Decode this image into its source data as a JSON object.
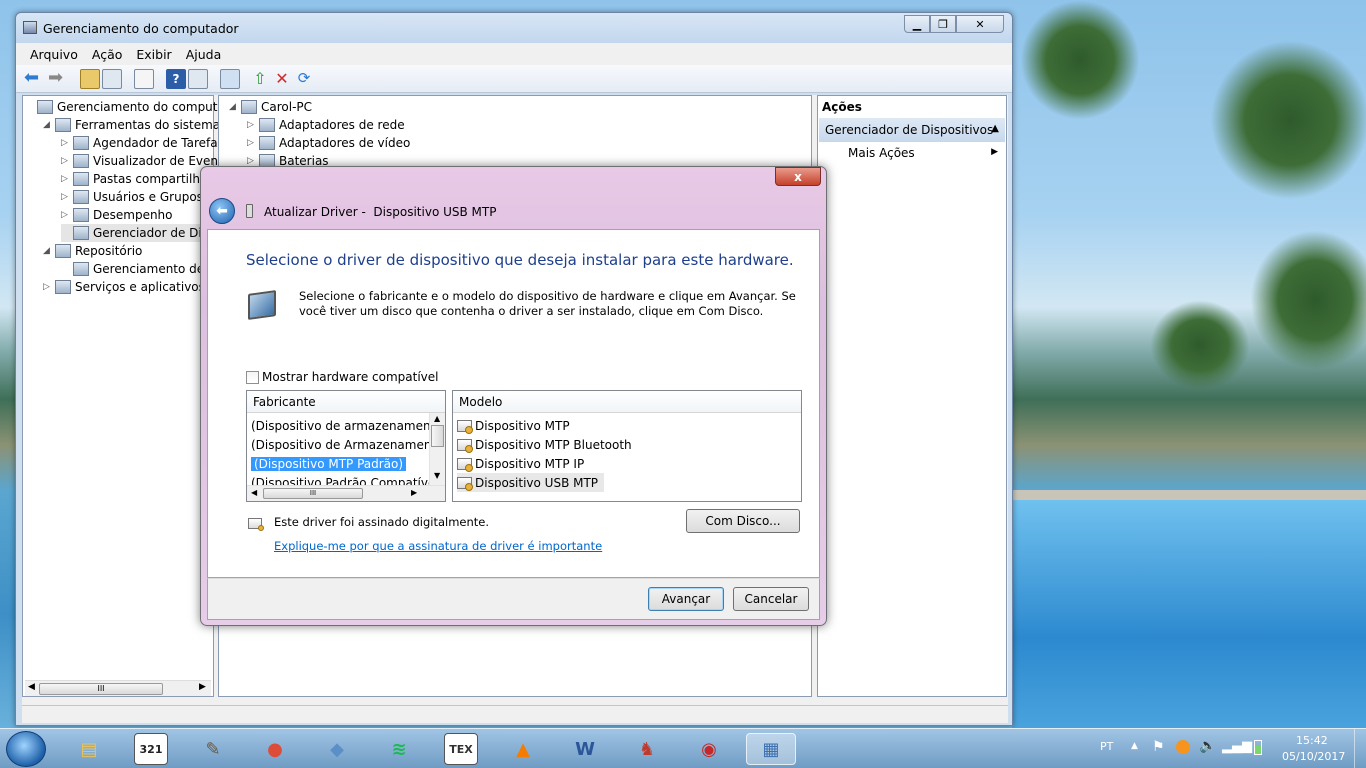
{
  "main_window": {
    "title": "Gerenciamento do computador",
    "menu": [
      "Arquivo",
      "Ação",
      "Exibir",
      "Ajuda"
    ],
    "left_tree": [
      {
        "label": "Gerenciamento do computado",
        "indent": 0,
        "arrow": ""
      },
      {
        "label": "Ferramentas do sistema",
        "indent": 1,
        "arrow": "◢"
      },
      {
        "label": "Agendador de Tarefas",
        "indent": 2,
        "arrow": "▷"
      },
      {
        "label": "Visualizador de Eventos",
        "indent": 2,
        "arrow": "▷"
      },
      {
        "label": "Pastas compartilhada",
        "indent": 2,
        "arrow": "▷"
      },
      {
        "label": "Usuários e Grupos Loc",
        "indent": 2,
        "arrow": "▷"
      },
      {
        "label": "Desempenho",
        "indent": 2,
        "arrow": "▷"
      },
      {
        "label": "Gerenciador de Dispo",
        "indent": 2,
        "arrow": ""
      },
      {
        "label": "Repositório",
        "indent": 1,
        "arrow": "◢"
      },
      {
        "label": "Gerenciamento de dis",
        "indent": 2,
        "arrow": ""
      },
      {
        "label": "Serviços e aplicativos",
        "indent": 1,
        "arrow": "▷"
      }
    ],
    "device_tree": [
      {
        "label": "Carol-PC",
        "indent": 0,
        "arrow": "◢"
      },
      {
        "label": "Adaptadores de rede",
        "indent": 1,
        "arrow": "▷"
      },
      {
        "label": "Adaptadores de vídeo",
        "indent": 1,
        "arrow": "▷"
      },
      {
        "label": "Baterias",
        "indent": 1,
        "arrow": "▷"
      }
    ],
    "actions": {
      "header": "Ações",
      "section": "Gerenciador de Dispositivos",
      "more": "Mais Ações"
    },
    "scroll_grip": "III"
  },
  "dialog": {
    "breadcrumb": "Atualizar Driver -  Dispositivo USB MTP",
    "heading": "Selecione o driver de dispositivo que deseja instalar para este hardware.",
    "description": "Selecione o fabricante e o modelo do dispositivo de hardware e clique em Avançar. Se você tiver um disco que contenha o driver a ser instalado, clique em Com Disco.",
    "checkbox_label": "Mostrar hardware compatível",
    "manufacturer_header": "Fabricante",
    "manufacturers": [
      "(Dispositivo de armazenamento a",
      "(Dispositivo de Armazenamento",
      "(Dispositivo MTP Padrão)",
      "(Dispositivo Padrão Compatível c"
    ],
    "selected_manufacturer_index": 2,
    "model_header": "Modelo",
    "models": [
      "Dispositivo MTP",
      "Dispositivo MTP Bluetooth",
      "Dispositivo MTP IP",
      "Dispositivo USB MTP"
    ],
    "selected_model_index": 3,
    "signed_text": "Este driver foi assinado digitalmente.",
    "signed_link": "Explique-me por que a assinatura de driver é importante",
    "have_disk": "Com Disco...",
    "next": "Avançar",
    "cancel": "Cancelar",
    "close": "x"
  },
  "taskbar": {
    "apps": [
      {
        "name": "file-explorer",
        "glyph": "▤",
        "color": "#e8c25a"
      },
      {
        "name": "media-player-classic",
        "glyph": "321",
        "color": "#222"
      },
      {
        "name": "gimp",
        "glyph": "✎",
        "color": "#6b5a3e"
      },
      {
        "name": "chrome",
        "glyph": "●",
        "color": "#dd4b39"
      },
      {
        "name": "virtualbox",
        "glyph": "◆",
        "color": "#5b8fc8"
      },
      {
        "name": "spotify",
        "glyph": "≋",
        "color": "#1db954"
      },
      {
        "name": "tex",
        "glyph": "TEX",
        "color": "#333"
      },
      {
        "name": "vlc",
        "glyph": "▲",
        "color": "#f57c00"
      },
      {
        "name": "word",
        "glyph": "W",
        "color": "#2b579a"
      },
      {
        "name": "game-character",
        "glyph": "♞",
        "color": "#c0392b"
      },
      {
        "name": "red-app",
        "glyph": "◉",
        "color": "#c62828"
      },
      {
        "name": "device-manager",
        "glyph": "▦",
        "color": "#3d6fb0"
      }
    ],
    "language": "PT",
    "time": "15:42",
    "date": "05/10/2017"
  }
}
